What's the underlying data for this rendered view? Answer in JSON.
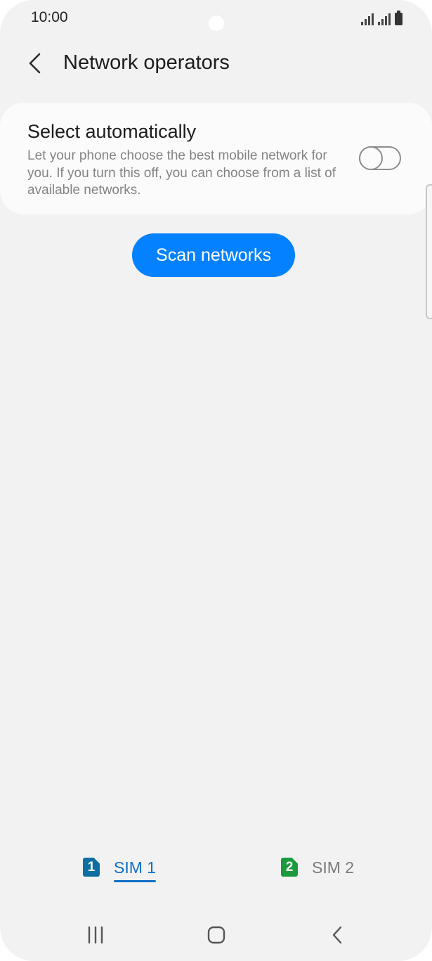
{
  "status_bar": {
    "time": "10:00"
  },
  "header": {
    "title": "Network operators",
    "back_icon": "chevron-left-icon"
  },
  "auto_select": {
    "title": "Select automatically",
    "description": "Let your phone choose the best mobile network for you. If you turn this off, you can choose from a list of available networks.",
    "toggle_on": false
  },
  "scan_button": {
    "label": "Scan networks",
    "color": "#0381fe"
  },
  "sim_tabs": [
    {
      "badge": "1",
      "label": "SIM 1",
      "active": true,
      "badge_color": "#0f6fa3"
    },
    {
      "badge": "2",
      "label": "SIM 2",
      "active": false,
      "badge_color": "#1a9a3a"
    }
  ],
  "nav_bar": {
    "recents_icon": "recent-apps-icon",
    "home_icon": "home-icon",
    "back_icon": "back-chevron-icon"
  }
}
